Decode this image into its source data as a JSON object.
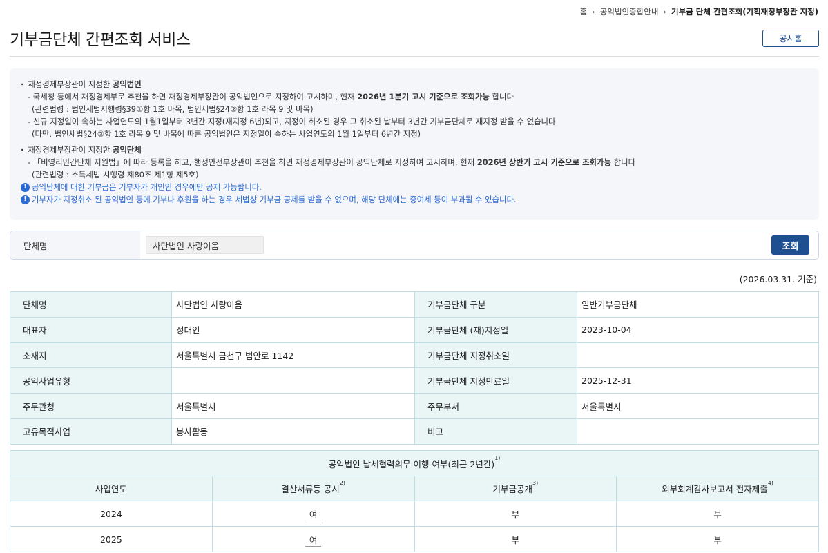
{
  "breadcrumb": {
    "home": "홈",
    "level1": "공익법인종합안내",
    "current": "기부금 단체 간편조회(기획재정부장관 지정)"
  },
  "page": {
    "title": "기부금단체 간편조회 서비스",
    "home_button": "공시홈"
  },
  "notice": {
    "sec1_head_prefix": "재정경제부장관이 지정한 ",
    "sec1_head_bold": "공익법인",
    "sec1_line1_a": "- 국세청 등에서 재정경제부로 추천을 하면 재정경제부장관이 공익법인으로 지정하여 고시하며, 현재 ",
    "sec1_line1_b": "2026년 1분기 고시 기준으로 조회가능",
    "sec1_line1_c": " 합니다",
    "sec1_line2": "(관련법령 : 법인세법시행령§39①항 1호 바목, 법인세법§24②항 1호 라목 9 및 바목)",
    "sec1_line3": "- 신규 지정일이 속하는 사업연도의 1월1일부터 3년간 지정(재지정 6년)되고, 지정이 취소된 경우 그 취소된 날부터 3년간 기부금단체로 재지정 받을 수 없습니다.",
    "sec1_line4": "(다만, 법인세법§24②항 1호 라목 9 및 바목에 따른 공익법인은 지정일이 속하는 사업연도의 1월 1일부터 6년간 지정)",
    "sec2_head_prefix": "재정경제부장관이 지정한 ",
    "sec2_head_bold": "공익단체",
    "sec2_line1_a": "- 「비영리민간단체 지원법」에 따라 등록을 하고, 행정안전부장관이 추천을 하면 재정경제부장관이 공익단체로 지정하여 고시하며, 현재 ",
    "sec2_line1_b": "2026년 상반기 고시 기준으로 조회가능",
    "sec2_line1_c": " 합니다",
    "sec2_line2": "(관련법령 : 소득세법 시행령 제80조 제1항 제5호)",
    "warn1": "공익단체에 대한 기부금은 기부자가 개인인 경우에만 공제 가능합니다.",
    "warn2": "기부자가 지정취소 된 공익법인 등에 기부나 후원을 하는 경우 세법상 기부금 공제를 받을 수 없으며, 해당 단체에는 증여세 등이 부과될 수 있습니다.",
    "warn_icon": "!"
  },
  "search": {
    "label": "단체명",
    "value": "사단법인 사랑이음",
    "button": "조회"
  },
  "basis_date": "(2026.03.31. 기준)",
  "info": {
    "rows": [
      {
        "k1": "단체명",
        "v1": "사단법인 사랑이음",
        "k2": "기부금단체 구분",
        "v2": "일반기부금단체"
      },
      {
        "k1": "대표자",
        "v1": "정대인",
        "k2": "기부금단체 (재)지정일",
        "v2": "2023-10-04"
      },
      {
        "k1": "소재지",
        "v1": "서울특별시 금천구 범안로 1142",
        "k2": "기부금단체 지정취소일",
        "v2": ""
      },
      {
        "k1": "공익사업유형",
        "v1": "",
        "k2": "기부금단체 지정만료일",
        "v2": "2025-12-31"
      },
      {
        "k1": "주무관청",
        "v1": "서울특별시",
        "k2": "주무부서",
        "v2": "서울특별시"
      },
      {
        "k1": "고유목적사업",
        "v1": "봉사활동",
        "k2": "비고",
        "v2": ""
      }
    ]
  },
  "compliance": {
    "caption": "공익법인 납세협력의무 이행 여부(최근 2년간)",
    "caption_sup": "1)",
    "headers": [
      {
        "label": "사업연도",
        "sup": ""
      },
      {
        "label": "결산서류등 공시",
        "sup": "2)"
      },
      {
        "label": "기부금공개",
        "sup": "3)"
      },
      {
        "label": "외부회계감사보고서 전자제출",
        "sup": "4)"
      }
    ],
    "rows": [
      {
        "year": "2024",
        "disclosure": "여",
        "donation": "부",
        "audit": "부"
      },
      {
        "year": "2025",
        "disclosure": "여",
        "donation": "부",
        "audit": "부"
      }
    ]
  }
}
